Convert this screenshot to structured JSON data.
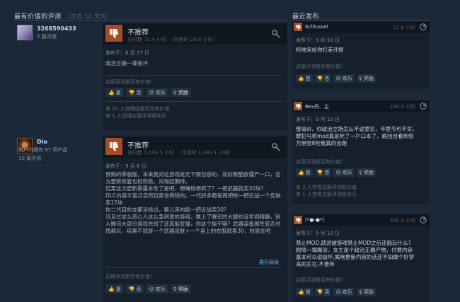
{
  "left_title": "最有价值的评测",
  "left_subtitle": "（过去 30 天内）",
  "right_title": "最近发布",
  "accent": "#66c0f4",
  "thumb_down_color": "#a34c25",
  "buttons": {
    "yes": "是",
    "no": "否",
    "funny": "欢乐",
    "award": "奖励"
  },
  "helpful_question": "这篇评测是否有价值？",
  "reviews": [
    {
      "author": "3268590433",
      "author_info": "5 篇评测",
      "verdict": "不推荐",
      "hours": "总时数 31.4 小时　（评测时 24.6 小时）",
      "posted": "发布于：8 月 27 日",
      "text": "政治正确一律差评",
      "stat1": "有 51 人觉得这篇评测有价值",
      "stat2": "有 1 人觉得这篇评测很欢乐"
    },
    {
      "author": "Dio",
      "author_info": "帐户内拥有 87 项产品",
      "author_info2": "10 篇评测",
      "verdict": "不推荐",
      "hours": "总时数 1,093.5 小时　（评测时 1,093.1 小时）",
      "posted": "发布于：9 月 8 日",
      "text": "预购的季版版，本来我对这游戏是无下限包容的，就好新酷欲僵尸一口，官方更新修复也挺积极，对得起期待。\n结果这次更新暴露本性了是吧，想赚钱想疯了？一把武器就卖30块？\nDLC内容丰富点自然玩家会掏钱的，一代好多都是两把枪一把近战一个皮肤卖15块\n你二代目前支都没给出，哪儿来的脸一把近战卖30?\n况且过这么恶心人这么急刺激的游戏，推上了腾讯的大腿也没学到精髓，别人腾讯大部分游戏充钱了还真能变强，你这个能干嘛？武器装备属性变态也找都以，结果不就是一个武器皮肤+一个身上的衣服就卖30，抢居去吧",
      "read_more": "展开阅读"
    }
  ],
  "recent": [
    {
      "name": "Schlussel",
      "hours": "27.8 小时",
      "posted": "发布于：9 月 10 日",
      "text": "特地来给你打差评捏"
    },
    {
      "name": "Rex丹、尘",
      "hours": "256.9 小时",
      "posted": "发布于：9 月 10 日",
      "text": "傻逼dl，你政治立场怎么不说意见，毕竟节也不买，\n罪犯马桥mod真是死了一户口本了，跌回目看到你\n万朋张8险我真的会跑",
      "stat1": "有 2 人觉得这篇评测有价值",
      "stat2": "有 1 人觉得这篇评测很欢乐"
    },
    {
      "name": "(*●-●*)",
      "hours": "305.3 小时",
      "posted": "发布于：9 月 10 日",
      "text": "禁止MOD,就这破游戏禁止MOD之后还能玩什么?\n剧情一塌糊涂，女主是个政治正确产物，付费内容\n基本可以说极坏,属啥更新内容的话还不如做个好梦\n来的实在,不推荐"
    }
  ]
}
